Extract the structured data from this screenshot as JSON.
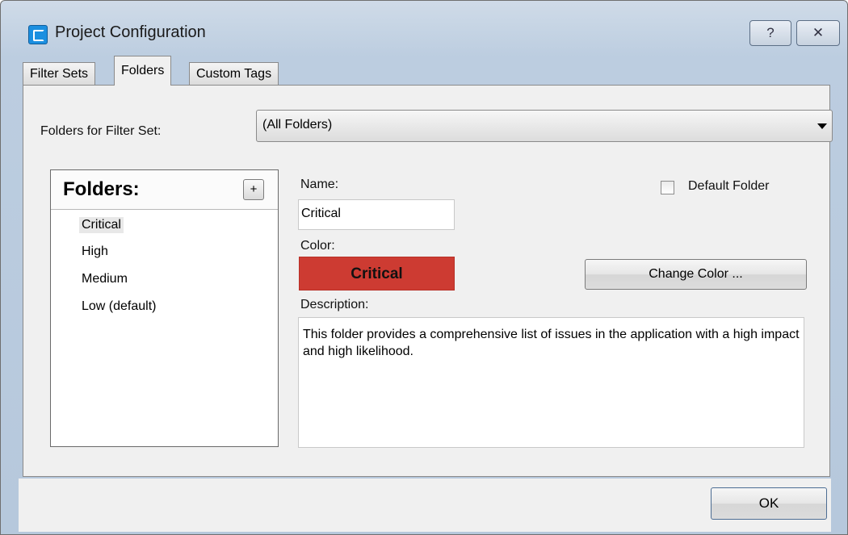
{
  "window": {
    "title": "Project Configuration",
    "help_label": "?",
    "close_label": "✕"
  },
  "tabs": [
    "Filter Sets",
    "Folders",
    "Custom Tags"
  ],
  "filter_set": {
    "label": "Folders for Filter Set:",
    "value": "(All Folders)"
  },
  "folders": {
    "title": "Folders:",
    "add_label": "+",
    "items": [
      "Critical",
      "High",
      "Medium",
      "Low (default)"
    ],
    "selected": "Critical"
  },
  "details": {
    "name_label": "Name:",
    "name_value": "Critical",
    "default_folder_label": "Default Folder",
    "color_label": "Color:",
    "color_swatch_text": "Critical",
    "color_hex": "#cd3b32",
    "change_color_label": "Change Color ...",
    "description_label": "Description:",
    "description_text": "This folder provides a comprehensive list of issues in the application with a high impact and high likelihood."
  },
  "footer": {
    "ok_label": "OK"
  }
}
